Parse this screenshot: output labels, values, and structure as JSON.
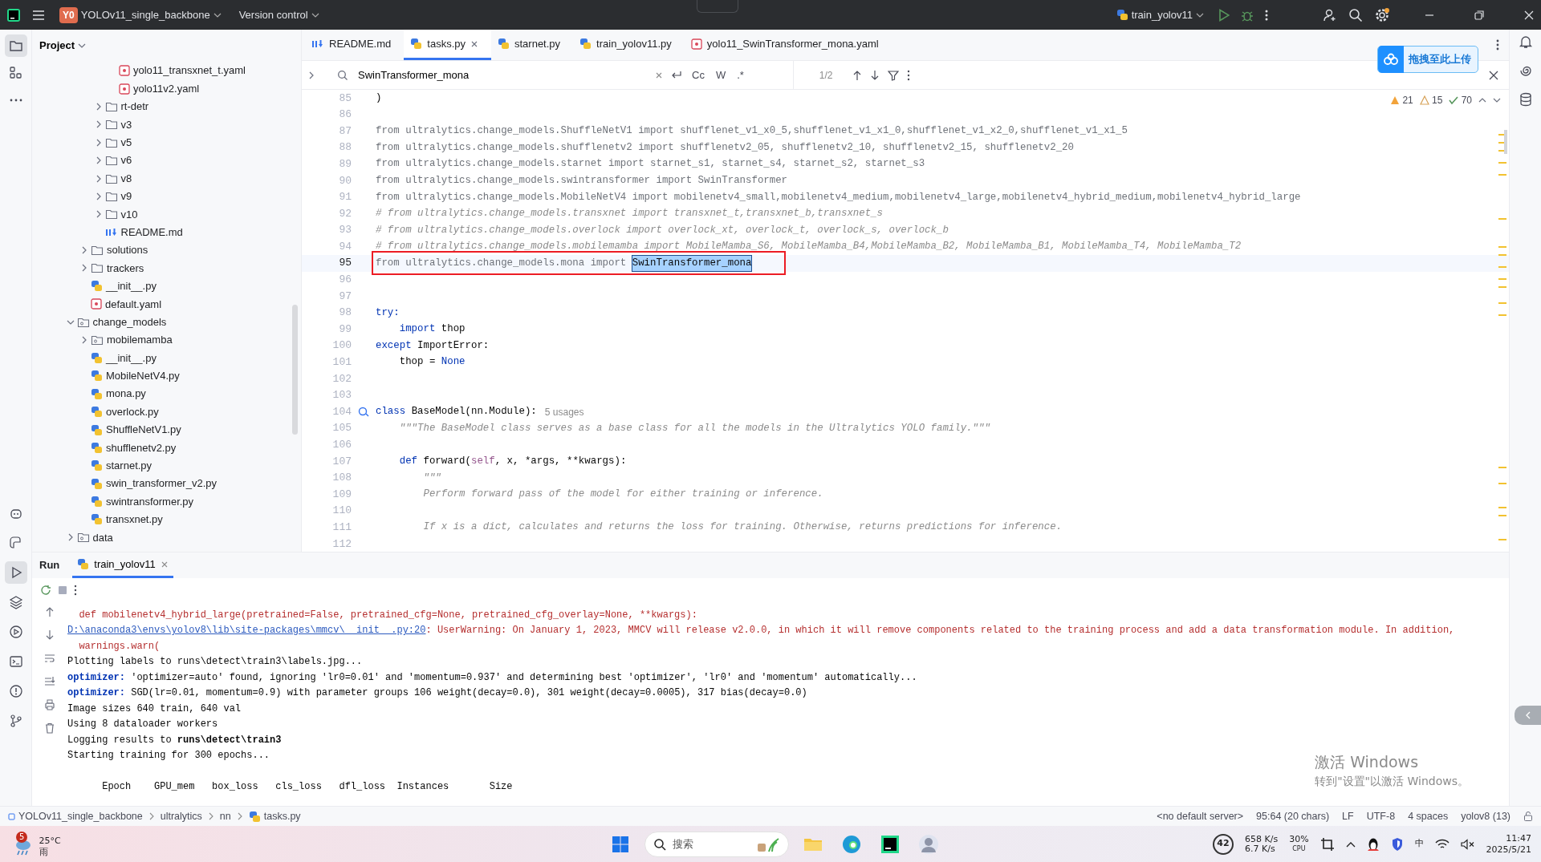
{
  "title_bar": {
    "project_badge": "Y0",
    "project": "YOLOv11_single_backbone",
    "vcs": "Version control",
    "run_config": "train_yolov11",
    "settings_badge": true
  },
  "tool_strip_top": [
    {
      "kind": "folder",
      "selected": true
    },
    {
      "kind": "structure",
      "selected": false
    },
    {
      "kind": "more",
      "selected": false
    }
  ],
  "tool_strip_bottom": [
    {
      "kind": "ai",
      "selected": false
    },
    {
      "kind": "console",
      "selected": false
    },
    {
      "kind": "run",
      "selected": true
    },
    {
      "kind": "layers",
      "selected": false
    },
    {
      "kind": "services",
      "selected": false
    },
    {
      "kind": "terminal",
      "selected": false
    },
    {
      "kind": "problems",
      "selected": false
    },
    {
      "kind": "git",
      "selected": false
    }
  ],
  "project_panel": {
    "title": "Project",
    "tree": [
      {
        "children": [
          {
            "children": [
              {
                "children": [
                  {
                    "label": "yolo11_transxnet_t.yaml",
                    "kind": "yaml"
                  },
                  {
                    "label": "yolo11v2.yaml",
                    "kind": "yaml"
                  }
                ]
              },
              {
                "label": "rt-detr",
                "kind": "folder",
                "expanded": false
              },
              {
                "label": "v3",
                "kind": "folder",
                "expanded": false
              },
              {
                "label": "v5",
                "kind": "folder",
                "expanded": false
              },
              {
                "label": "v6",
                "kind": "folder",
                "expanded": false
              },
              {
                "label": "v8",
                "kind": "folder",
                "expanded": false
              },
              {
                "label": "v9",
                "kind": "folder",
                "expanded": false
              },
              {
                "label": "v10",
                "kind": "folder",
                "expanded": false
              },
              {
                "label": "README.md",
                "kind": "markdown"
              }
            ]
          },
          {
            "label": "solutions",
            "kind": "folder",
            "expanded": false
          },
          {
            "label": "trackers",
            "kind": "folder",
            "expanded": false
          },
          {
            "label": "__init__.py",
            "kind": "python"
          },
          {
            "label": "default.yaml",
            "kind": "yaml"
          }
        ]
      },
      {
        "label": "change_models",
        "kind": "package",
        "expanded": true,
        "children": [
          {
            "label": "mobilemamba",
            "kind": "package",
            "expanded": false
          },
          {
            "label": "__init__.py",
            "kind": "python"
          },
          {
            "label": "MobileNetV4.py",
            "kind": "python"
          },
          {
            "label": "mona.py",
            "kind": "python"
          },
          {
            "label": "overlock.py",
            "kind": "python"
          },
          {
            "label": "ShuffleNetV1.py",
            "kind": "python"
          },
          {
            "label": "shufflenetv2.py",
            "kind": "python"
          },
          {
            "label": "starnet.py",
            "kind": "python"
          },
          {
            "label": "swin_transformer_v2.py",
            "kind": "python"
          },
          {
            "label": "swintransformer.py",
            "kind": "python"
          },
          {
            "label": "transxnet.py",
            "kind": "python"
          }
        ]
      },
      {
        "label": "data",
        "kind": "package",
        "expanded": false
      }
    ]
  },
  "tabs": [
    {
      "label": "README.md",
      "kind": "markdown",
      "selected": false
    },
    {
      "label": "tasks.py",
      "kind": "python",
      "selected": true
    },
    {
      "label": "starnet.py",
      "kind": "python",
      "selected": false
    },
    {
      "label": "train_yolov11.py",
      "kind": "python",
      "selected": false
    },
    {
      "label": "yolo11_SwinTransformer_mona.yaml",
      "kind": "yaml",
      "selected": false
    }
  ],
  "upload_button": "拖拽至此上传",
  "find_bar": {
    "query": "SwinTransformer_mona",
    "match_case": "Cc",
    "words": "W",
    "regex": ".*",
    "count": "1/2"
  },
  "inspections": {
    "warnings": "21",
    "weak_warnings": "15",
    "ok": "70"
  },
  "code_lines": [
    {
      "number": "85",
      "segments": [
        {
          "text": ")",
          "kind": "plain"
        }
      ]
    },
    {
      "number": "86"
    },
    {
      "number": "87",
      "segments": [
        {
          "text": "from ultralytics.change_models.ShuffleNetV1 import shufflenet_v1_x0_5,shufflenet_v1_x1_0,shufflenet_v1_x2_0,shufflenet_v1_x1_5",
          "kind": "unused"
        }
      ]
    },
    {
      "number": "88",
      "segments": [
        {
          "text": "from ultralytics.change_models.shufflenetv2 import shufflenetv2_05, shufflenetv2_10, shufflenetv2_15, shufflenetv2_20",
          "kind": "unused"
        }
      ]
    },
    {
      "number": "89",
      "segments": [
        {
          "text": "from ultralytics.change_models.starnet import starnet_s1, starnet_s4, starnet_s2, starnet_s3",
          "kind": "unused"
        }
      ]
    },
    {
      "number": "90",
      "segments": [
        {
          "text": "from ultralytics.change_models.swintransformer import SwinTransformer",
          "kind": "unused"
        }
      ]
    },
    {
      "number": "91",
      "segments": [
        {
          "text": "from ultralytics.change_models.MobileNetV4 import mobilenetv4_small,mobilenetv4_medium,mobilenetv4_large,mobilenetv4_hybrid_medium,mobilenetv4_hybrid_large",
          "kind": "unused"
        }
      ]
    },
    {
      "number": "92",
      "segments": [
        {
          "text": "# from ultralytics.change_models.transxnet import transxnet_t,transxnet_b,transxnet_s",
          "kind": "comment"
        }
      ]
    },
    {
      "number": "93",
      "segments": [
        {
          "text": "# from ultralytics.change_models.overlock import overlock_xt, overlock_t, overlock_s, overlock_b",
          "kind": "comment"
        }
      ]
    },
    {
      "number": "94",
      "segments": [
        {
          "text": "# from ultralytics.change_models.mobilemamba import MobileMamba_S6, MobileMamba_B4,MobileMamba_B2, MobileMamba_B1, MobileMamba_T4, MobileMamba_T2",
          "kind": "comment"
        }
      ]
    },
    {
      "number": "95",
      "current": true,
      "boxed": true,
      "segments": [
        {
          "text": "from ultralytics.change_models.mona import ",
          "kind": "unused"
        },
        {
          "text": "SwinTransformer_mona",
          "kind": "match"
        }
      ]
    },
    {
      "number": "96"
    },
    {
      "number": "97"
    },
    {
      "number": "98",
      "segments": [
        {
          "text": "try:",
          "kind": "keyword"
        }
      ]
    },
    {
      "number": "99",
      "segments": [
        {
          "text": "    import ",
          "kind": "keyword"
        },
        {
          "text": "thop",
          "kind": "plain"
        }
      ]
    },
    {
      "number": "100",
      "segments": [
        {
          "text": "except ",
          "kind": "keyword"
        },
        {
          "text": "ImportError:",
          "kind": "plain"
        }
      ]
    },
    {
      "number": "101",
      "segments": [
        {
          "text": "    thop = ",
          "kind": "plain"
        },
        {
          "text": "None",
          "kind": "keyword"
        }
      ]
    },
    {
      "number": "102"
    },
    {
      "number": "103"
    },
    {
      "number": "104",
      "marker": true,
      "segments": [
        {
          "text": "class ",
          "kind": "keyword"
        },
        {
          "text": "BaseModel(nn.Module):",
          "kind": "plain"
        },
        {
          "text": "5 usages",
          "kind": "hint"
        }
      ]
    },
    {
      "number": "105",
      "segments": [
        {
          "text": "    \"\"\"The BaseModel class serves as a base class for all the models in the Ultralytics YOLO family.\"\"\"",
          "kind": "doc"
        }
      ]
    },
    {
      "number": "106"
    },
    {
      "number": "107",
      "segments": [
        {
          "text": "    def ",
          "kind": "keyword"
        },
        {
          "text": "forward(",
          "kind": "plain"
        },
        {
          "text": "self",
          "kind": "self"
        },
        {
          "text": ", x, *args, **kwargs):",
          "kind": "plain"
        }
      ]
    },
    {
      "number": "108",
      "segments": [
        {
          "text": "        \"\"\"",
          "kind": "doc"
        }
      ]
    },
    {
      "number": "109",
      "segments": [
        {
          "text": "        Perform forward pass of the model for either training or inference.",
          "kind": "doc"
        }
      ]
    },
    {
      "number": "110"
    },
    {
      "number": "111",
      "segments": [
        {
          "text": "        If x is a dict, calculates and returns the loss for training. Otherwise, returns predictions for inference.",
          "kind": "doc"
        }
      ]
    },
    {
      "number": "112"
    }
  ],
  "run_panel": {
    "title": "Run",
    "tab": "train_yolov11",
    "console": [
      {
        "segments": [
          {
            "text": "  def mobilenetv4_hybrid_large(pretrained=False, pretrained_cfg=None, pretrained_cfg_overlay=None, **kwargs):",
            "kind": "error"
          }
        ]
      },
      {
        "segments": [
          {
            "text": "D:\\anaconda3\\envs\\yolov8\\lib\\site-packages\\mmcv\\__init__.py:20",
            "kind": "link"
          },
          {
            "text": ": UserWarning: On January 1, 2023, MMCV will release v2.0.0, in which it will remove components related to the training process and add a data transformation module. In addition,",
            "kind": "error"
          }
        ]
      },
      {
        "segments": [
          {
            "text": "  warnings.warn(",
            "kind": "error"
          }
        ]
      },
      {
        "segments": [
          {
            "text": "Plotting labels to runs\\detect\\train3\\labels.jpg... ",
            "kind": "plain"
          }
        ]
      },
      {
        "segments": [
          {
            "text": "optimizer:",
            "kind": "label"
          },
          {
            "text": " 'optimizer=auto' found, ignoring 'lr0=0.01' and 'momentum=0.937' and determining best 'optimizer', 'lr0' and 'momentum' automatically... ",
            "kind": "plain"
          }
        ]
      },
      {
        "segments": [
          {
            "text": "optimizer:",
            "kind": "label"
          },
          {
            "text": " SGD(lr=0.01, momentum=0.9) with parameter groups 106 weight(decay=0.0), 301 weight(decay=0.0005), 317 bias(decay=0.0)",
            "kind": "plain"
          }
        ]
      },
      {
        "segments": [
          {
            "text": "Image sizes 640 train, 640 val",
            "kind": "plain"
          }
        ]
      },
      {
        "segments": [
          {
            "text": "Using 8 dataloader workers",
            "kind": "plain"
          }
        ]
      },
      {
        "segments": [
          {
            "text": "Logging results to ",
            "kind": "plain"
          },
          {
            "text": "runs\\detect\\train3",
            "kind": "bold"
          }
        ]
      },
      {
        "segments": [
          {
            "text": "Starting training for 300 epochs...",
            "kind": "plain"
          }
        ]
      },
      {
        "kind": "blank"
      },
      {
        "segments": [
          {
            "text": "      Epoch    GPU_mem   box_loss   cls_loss   dfl_loss  Instances       Size",
            "kind": "plain"
          }
        ]
      }
    ]
  },
  "activation_notice": {
    "title": "激活 Windows",
    "subtitle": "转到\"设置\"以激活 Windows。"
  },
  "status_bar": {
    "breadcrumbs": [
      "YOLOv11_single_backbone",
      "ultralytics",
      "nn",
      "tasks.py"
    ],
    "items": [
      "<no default server>",
      "95:64 (20 chars)",
      "LF",
      "UTF-8",
      "4 spaces",
      "yolov8 (13)"
    ]
  },
  "taskbar": {
    "weather_badge": "5",
    "temperature": "25°C",
    "condition": "雨",
    "search": "搜索",
    "tray_badge": "42",
    "upload_speed": "658 K/s",
    "download_speed": "6.7 K/s",
    "cpu_value": "30%",
    "cpu_label": "CPU",
    "ime": "中",
    "time": "11:47",
    "date": "2025/5/21"
  }
}
